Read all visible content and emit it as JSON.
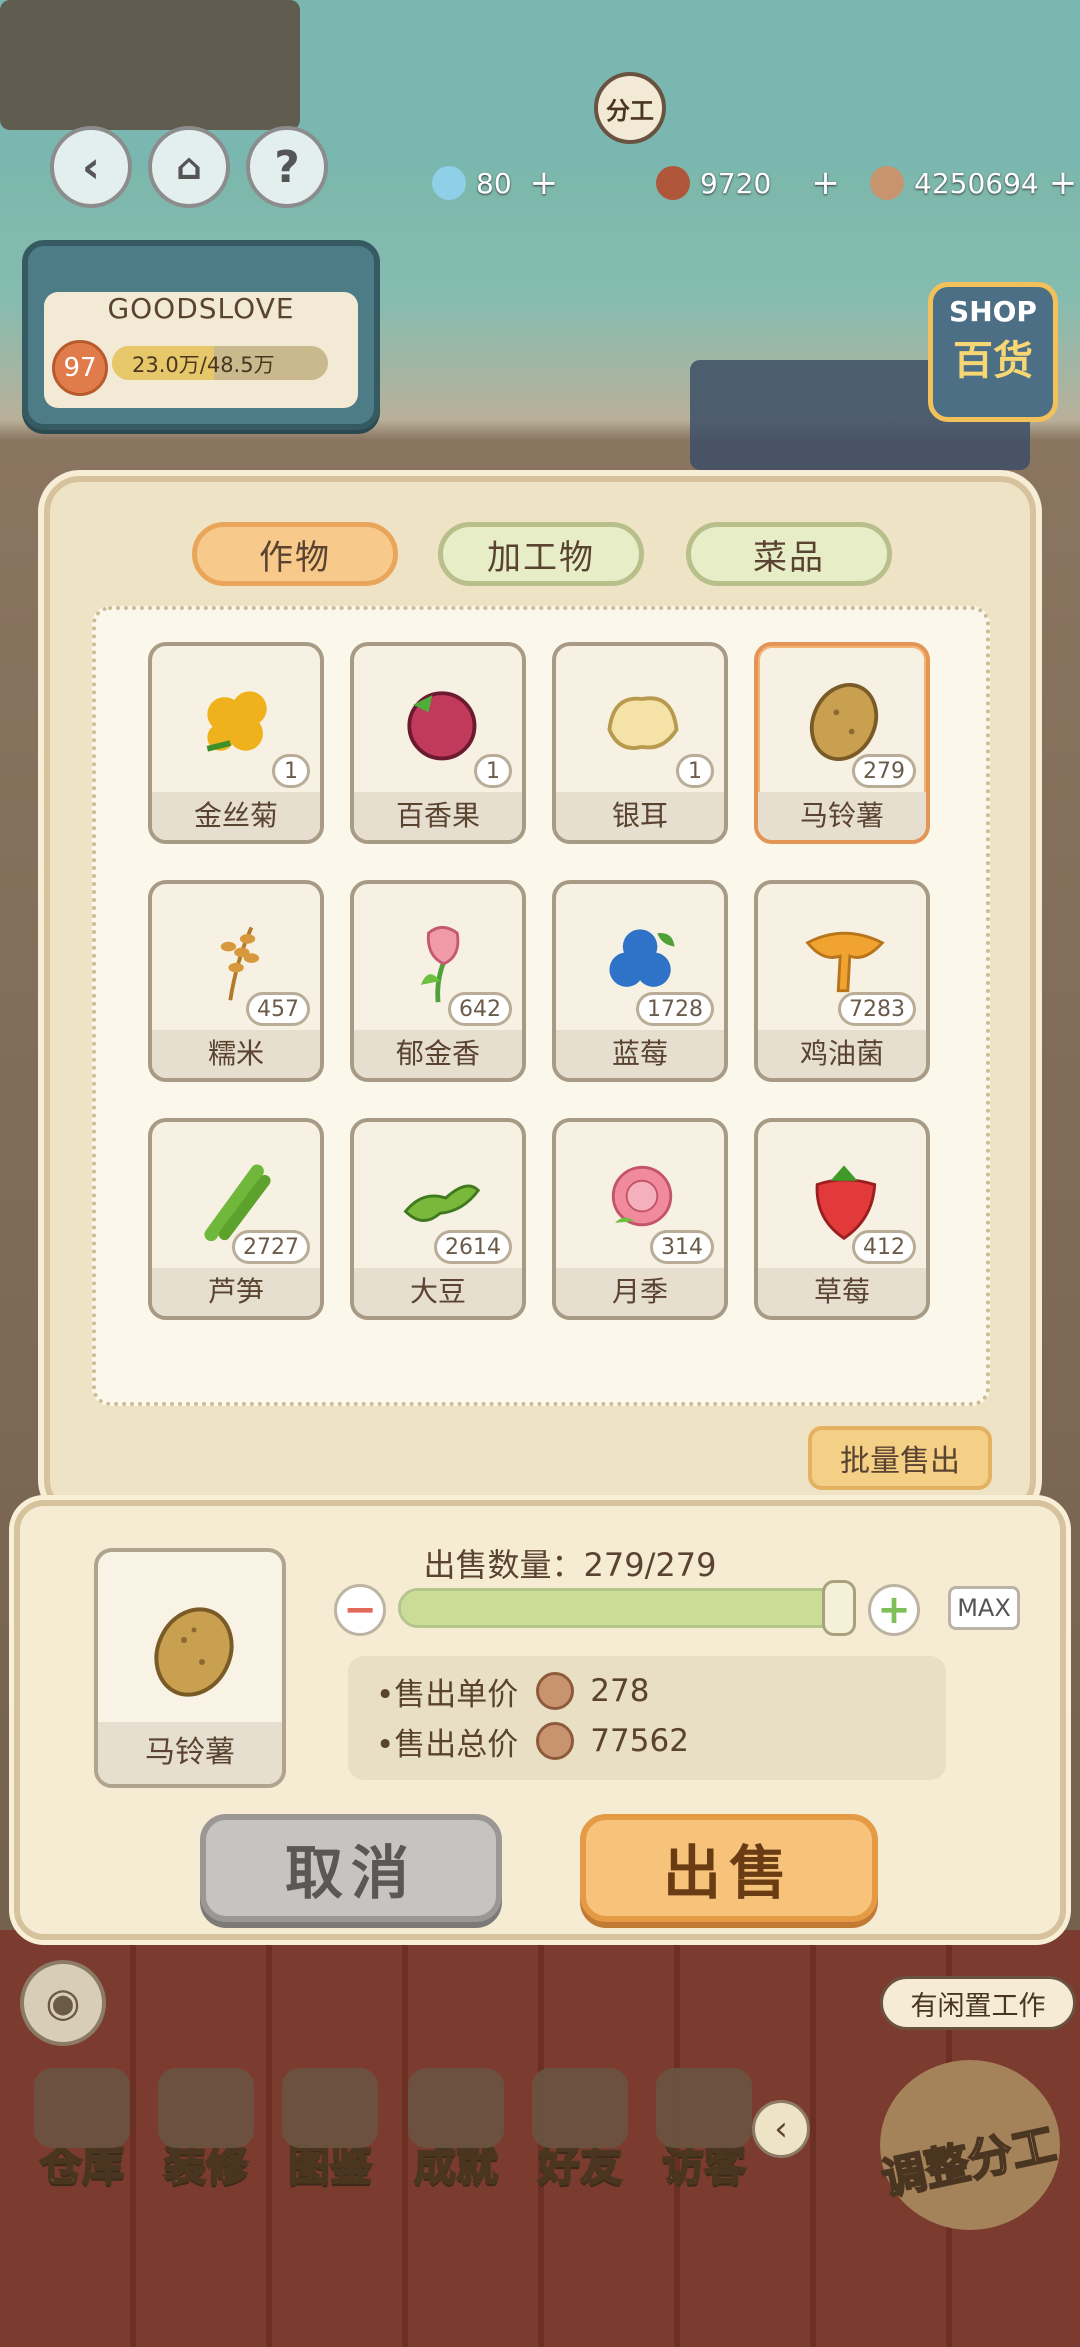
{
  "hud": {
    "work_bubble": "分工",
    "gems": "80",
    "chestnuts": "9720",
    "coins": "4250694",
    "plus": "+"
  },
  "status": {
    "name": "GOODSLOVE",
    "level": "97",
    "progress_text": "23.0万/48.5万",
    "progress_fraction": 0.47
  },
  "shop_sign": {
    "en": "SHOP",
    "cn": "百货"
  },
  "tabs": [
    {
      "label": "作物",
      "active": true
    },
    {
      "label": "加工物",
      "active": false
    },
    {
      "label": "菜品",
      "active": false
    }
  ],
  "items": [
    {
      "name": "金丝菊",
      "count": "1",
      "icon": "golden-chrysanthemum-icon",
      "color": "#f0b21c"
    },
    {
      "name": "百香果",
      "count": "1",
      "icon": "passion-fruit-icon",
      "color": "#c23a5b"
    },
    {
      "name": "银耳",
      "count": "1",
      "icon": "white-fungus-icon",
      "color": "#f4e2a6"
    },
    {
      "name": "马铃薯",
      "count": "279",
      "icon": "potato-icon",
      "color": "#c9a050"
    },
    {
      "name": "糯米",
      "count": "457",
      "icon": "glutinous-rice-icon",
      "color": "#d8983e"
    },
    {
      "name": "郁金香",
      "count": "642",
      "icon": "tulip-icon",
      "color": "#f19aa8"
    },
    {
      "name": "蓝莓",
      "count": "1728",
      "icon": "blueberry-icon",
      "color": "#2f73c9"
    },
    {
      "name": "鸡油菌",
      "count": "7283",
      "icon": "chanterelle-icon",
      "color": "#f0a330"
    },
    {
      "name": "芦笋",
      "count": "2727",
      "icon": "asparagus-icon",
      "color": "#6fb83b"
    },
    {
      "name": "大豆",
      "count": "2614",
      "icon": "soybean-icon",
      "color": "#79b83a"
    },
    {
      "name": "月季",
      "count": "314",
      "icon": "rose-icon",
      "color": "#f08a9c"
    },
    {
      "name": "草莓",
      "count": "412",
      "icon": "strawberry-icon",
      "color": "#e23a3a"
    }
  ],
  "batch_sell": "批量售出",
  "sell": {
    "item_name": "马铃薯",
    "quantity_label": "出售数量：279/279",
    "quantity_fraction": 1.0,
    "max_label": "MAX",
    "unit_price_label": "•售出单价",
    "unit_price": "278",
    "total_price_label": "•售出总价",
    "total_price": "77562",
    "cancel": "取消",
    "confirm": "出售"
  },
  "nav": [
    {
      "label": "仓库"
    },
    {
      "label": "装修"
    },
    {
      "label": "图鉴"
    },
    {
      "label": "成就"
    },
    {
      "label": "好友"
    },
    {
      "label": "访客"
    }
  ],
  "idle_tip": "有闲置工作",
  "adjust": "调整分工"
}
